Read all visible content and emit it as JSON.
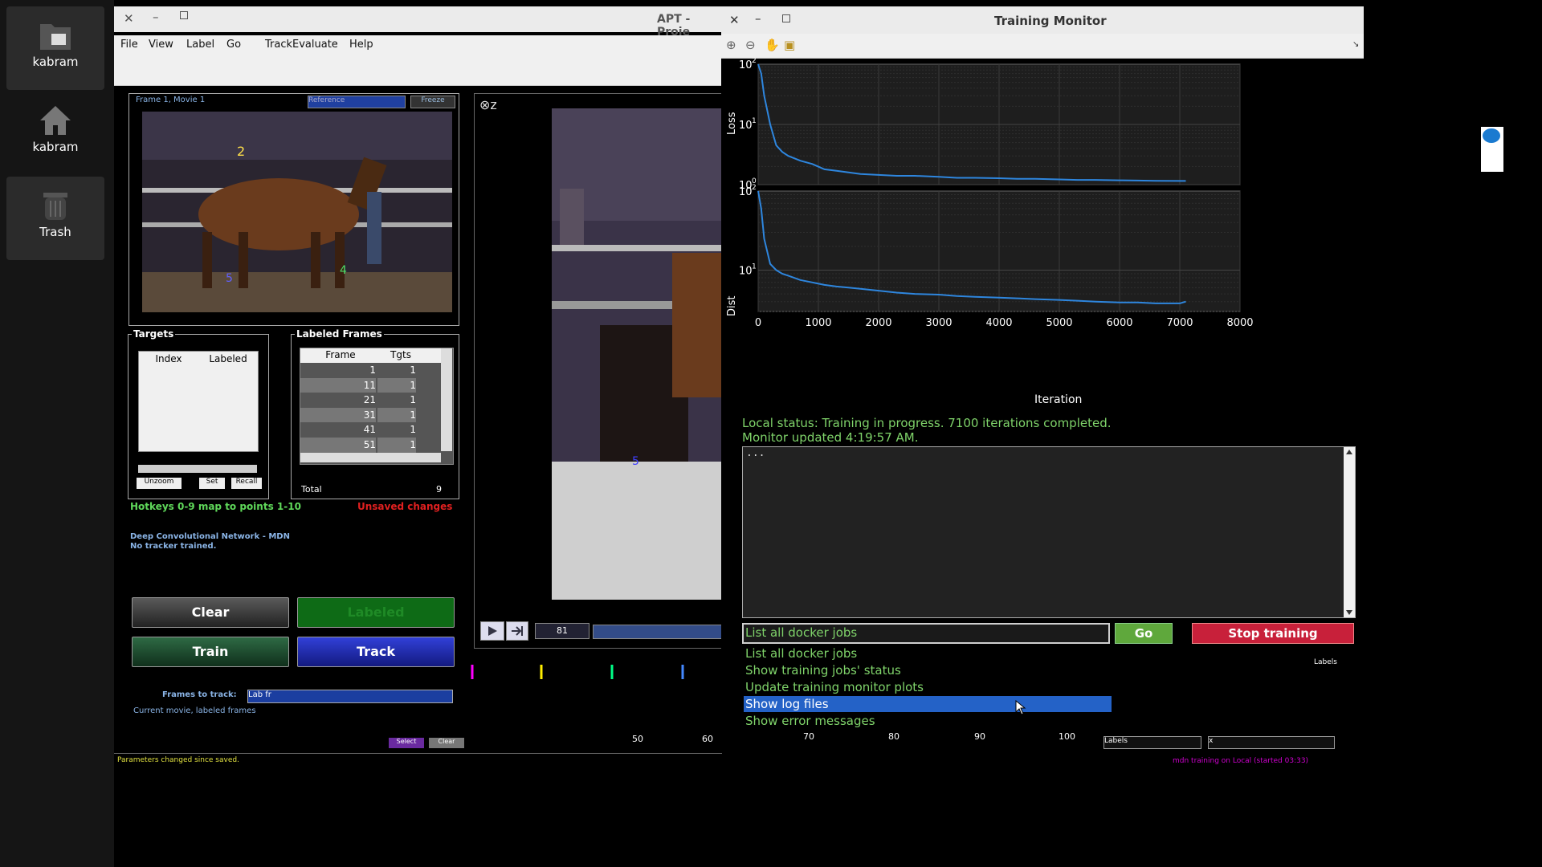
{
  "desktop": {
    "icons": [
      {
        "label": "kabram",
        "icon": "folder-icon"
      },
      {
        "label": "kabram",
        "icon": "home-icon"
      },
      {
        "label": "Trash",
        "icon": "trash-icon"
      }
    ]
  },
  "apt": {
    "title": "APT - Proje",
    "menu": [
      "File",
      "View",
      "Label",
      "Go",
      "Track",
      "Evaluate",
      "Help"
    ],
    "frame_panel": {
      "title": "Frame 1, Movie 1",
      "dropdown": "Reference",
      "freeze": "Freeze",
      "points": [
        "2",
        "4",
        "5"
      ]
    },
    "targets": {
      "title": "Targets",
      "col_index": "Index",
      "col_labeled": "Labeled",
      "unzoom": "Unzoom",
      "set": "Set",
      "recall": "Recall"
    },
    "labeled_frames": {
      "title": "Labeled Frames",
      "col_frame": "Frame",
      "col_tgts": "Tgts",
      "rows": [
        {
          "frame": "1",
          "tgts": "1"
        },
        {
          "frame": "11",
          "tgts": "1"
        },
        {
          "frame": "21",
          "tgts": "1"
        },
        {
          "frame": "31",
          "tgts": "1"
        },
        {
          "frame": "41",
          "tgts": "1"
        },
        {
          "frame": "51",
          "tgts": "1"
        }
      ],
      "total_label": "Total",
      "total_value": "9"
    },
    "hotkeys": "Hotkeys 0-9 map to points 1-10",
    "unsaved": "Unsaved changes",
    "tracker_line1": "Deep Convolutional Network - MDN",
    "tracker_line2": "No tracker trained.",
    "buttons": {
      "clear": "Clear",
      "labeled": "Labeled",
      "train": "Train",
      "track": "Track"
    },
    "frames_to_track_label": "Frames to track:",
    "frames_to_track_value": "Lab fr",
    "current_movie": "Current movie, labeled frames",
    "main_view_point": "5",
    "frame_field": "81",
    "timeline": {
      "select": "Select",
      "clear": "Clear",
      "ticks": [
        "50",
        "60",
        "70",
        "80",
        "90",
        "100"
      ],
      "labels_text": "Labels",
      "labels_field": "Labels",
      "x_field": "x"
    },
    "status_left": "Parameters changed since  saved.",
    "status_right": "mdn training on Local (started 03:33)"
  },
  "monitor": {
    "title": "Training Monitor",
    "plot1_ylabel": "Loss",
    "plot2_ylabel": "Dist",
    "plot1_yticks": [
      "10",
      "10",
      "10"
    ],
    "plot1_yexp": [
      "2",
      "1",
      "0"
    ],
    "plot2_yticks": [
      "10",
      "10"
    ],
    "plot2_yexp": [
      "2",
      "1"
    ],
    "xticks": [
      "0",
      "1000",
      "2000",
      "3000",
      "4000",
      "5000",
      "6000",
      "7000",
      "8000"
    ],
    "xlabel": "Iteration",
    "status1": "Local status: Training in progress. 7100 iterations completed.",
    "status2": "Monitor updated  4:19:57 AM.",
    "log_text": "...",
    "action_value": "List all docker jobs",
    "go": "Go",
    "stop": "Stop training",
    "dropdown_items": [
      "List all docker jobs",
      "Show training jobs' status",
      "Update training monitor plots",
      "Show log files",
      "Show error messages"
    ],
    "selected_index": 3
  },
  "chart_data": [
    {
      "type": "line",
      "ylabel": "Loss",
      "xlabel": "",
      "yscale": "log",
      "xlim": [
        0,
        8000
      ],
      "ylim": [
        1,
        100
      ],
      "series": [
        {
          "x": [
            0,
            50,
            100,
            200,
            300,
            400,
            500,
            700,
            900,
            1100,
            1300,
            1500,
            1700,
            2000,
            2300,
            2600,
            3000,
            3300,
            3600,
            4000,
            4300,
            4600,
            5000,
            5300,
            5600,
            6000,
            6300,
            6600,
            7000,
            7100
          ],
          "y": [
            100,
            70,
            30,
            10,
            4.5,
            3.5,
            3.0,
            2.5,
            2.2,
            1.8,
            1.7,
            1.6,
            1.5,
            1.45,
            1.4,
            1.4,
            1.35,
            1.3,
            1.3,
            1.28,
            1.25,
            1.25,
            1.22,
            1.2,
            1.2,
            1.18,
            1.17,
            1.16,
            1.15,
            1.15
          ]
        }
      ],
      "grid": true
    },
    {
      "type": "line",
      "ylabel": "Dist",
      "xlabel": "Iteration",
      "yscale": "log",
      "xlim": [
        0,
        8000
      ],
      "ylim": [
        3,
        100
      ],
      "series": [
        {
          "x": [
            0,
            50,
            100,
            200,
            300,
            400,
            500,
            700,
            900,
            1100,
            1300,
            1500,
            1700,
            2000,
            2300,
            2600,
            3000,
            3300,
            3600,
            4000,
            4300,
            4600,
            5000,
            5300,
            5600,
            6000,
            6300,
            6600,
            7000,
            7100
          ],
          "y": [
            100,
            60,
            25,
            12,
            10,
            9,
            8.5,
            7.5,
            7,
            6.5,
            6.2,
            6,
            5.8,
            5.5,
            5.2,
            5,
            4.9,
            4.7,
            4.6,
            4.5,
            4.4,
            4.3,
            4.2,
            4.1,
            4.0,
            3.9,
            3.9,
            3.8,
            3.8,
            4.0
          ]
        }
      ],
      "grid": true
    }
  ],
  "colors": {
    "line": "#2e86de",
    "plot_bg": "#1e1e1e",
    "status_green": "#7fd36a",
    "stop_red": "#c8203a",
    "go_green": "#5fa83c",
    "track_blue": "#2029a8",
    "train_green": "#1f4a2f",
    "labeled_green": "#0e6b16",
    "selection_blue": "#2462c7"
  }
}
